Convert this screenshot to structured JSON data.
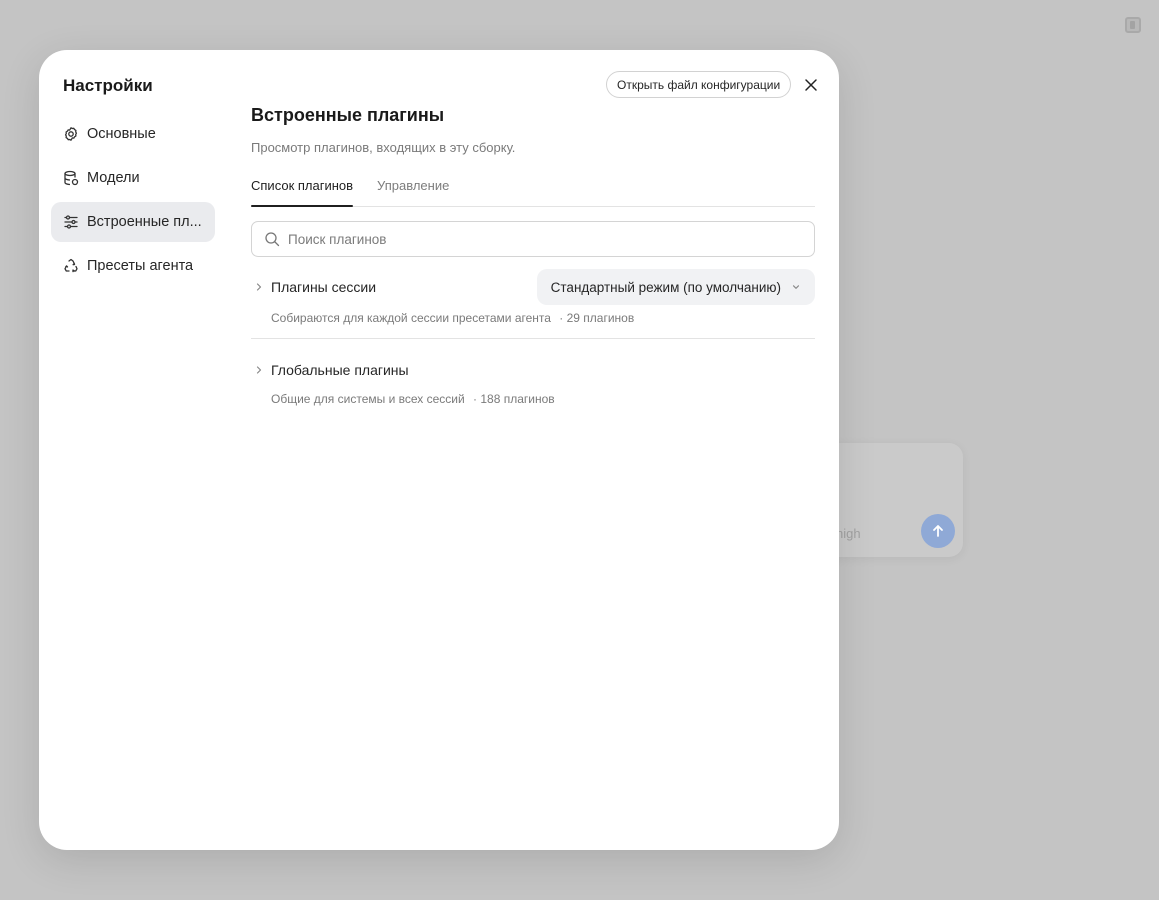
{
  "background": {
    "reasoning_label": "high"
  },
  "modal": {
    "title": "Настройки",
    "open_config_label": "Открыть файл конфигурации",
    "nav": [
      {
        "label": "Основные",
        "icon": "gear-icon"
      },
      {
        "label": "Модели",
        "icon": "database-icon"
      },
      {
        "label": "Встроенные пл...",
        "icon": "sliders-icon",
        "active": true
      },
      {
        "label": "Пресеты агента",
        "icon": "recycle-icon"
      }
    ]
  },
  "content": {
    "title": "Встроенные плагины",
    "subtitle": "Просмотр плагинов, входящих в эту сборку.",
    "tabs": [
      {
        "label": "Список плагинов",
        "active": true
      },
      {
        "label": "Управление",
        "active": false
      }
    ],
    "search_placeholder": "Поиск плагинов",
    "groups": [
      {
        "name": "Плагины сессии",
        "description": "Собираются для каждой сессии пресетами агента",
        "count": "· 29 плагинов",
        "mode": "Стандартный режим (по умолчанию)"
      },
      {
        "name": "Глобальные плагины",
        "description": "Общие для системы и всех сессий",
        "count": "· 188 плагинов"
      }
    ]
  },
  "colors": {
    "overlay": "#c4c4c4",
    "modal_bg": "#ffffff",
    "active_nav": "#eaebee",
    "send_button": "#8fa9d6"
  }
}
